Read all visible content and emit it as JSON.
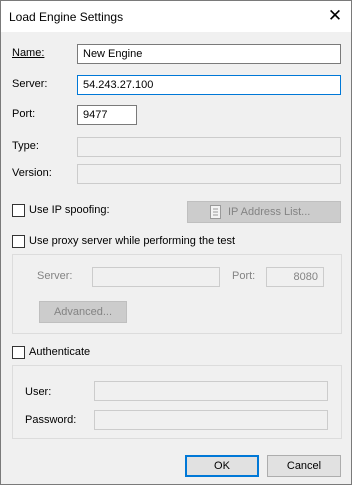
{
  "window": {
    "title": "Load Engine Settings",
    "close_glyph": "✕"
  },
  "fields": {
    "name": {
      "label": "Name:",
      "value": "New Engine"
    },
    "server": {
      "label": "Server:",
      "value": "54.243.27.100"
    },
    "port": {
      "label": "Port:",
      "value": "9477"
    },
    "type": {
      "label": "Type:",
      "value": ""
    },
    "version": {
      "label": "Version:",
      "value": ""
    }
  },
  "ip_spoofing": {
    "label": "Use IP spoofing:",
    "button": "IP Address List...",
    "checked": false
  },
  "proxy": {
    "label": "Use proxy server while performing the test",
    "checked": false,
    "server_label": "Server:",
    "server_value": "",
    "port_label": "Port:",
    "port_value": "8080",
    "advanced_button": "Advanced..."
  },
  "auth": {
    "label": "Authenticate",
    "checked": false,
    "user_label": "User:",
    "user_value": "",
    "password_label": "Password:",
    "password_value": ""
  },
  "buttons": {
    "ok": "OK",
    "cancel": "Cancel"
  },
  "icons": {
    "ip-list": "document-list-icon",
    "close": "close-icon"
  }
}
